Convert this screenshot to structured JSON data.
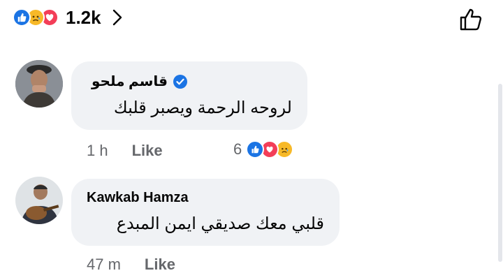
{
  "post_reactions": {
    "total": "1.2k",
    "icons": [
      "like-icon",
      "sad-icon",
      "love-icon"
    ]
  },
  "comments": [
    {
      "author": "قاسم ملحو",
      "verified": true,
      "text": "لروحه الرحمة ويصبر قلبك",
      "time": "1 h",
      "like_label": "Like",
      "reaction_count": "6",
      "reaction_icons": [
        "like-icon",
        "love-icon",
        "sad-icon"
      ]
    },
    {
      "author": "Kawkab Hamza",
      "verified": false,
      "text": "قلبي معك صديقي ايمن المبدع",
      "time": "47 m",
      "like_label": "Like"
    }
  ],
  "colors": {
    "like": "#1b74e4",
    "love": "#f33e58",
    "sad": "#f7b928",
    "bubble": "#f0f2f5",
    "meta_text": "#65676b"
  }
}
